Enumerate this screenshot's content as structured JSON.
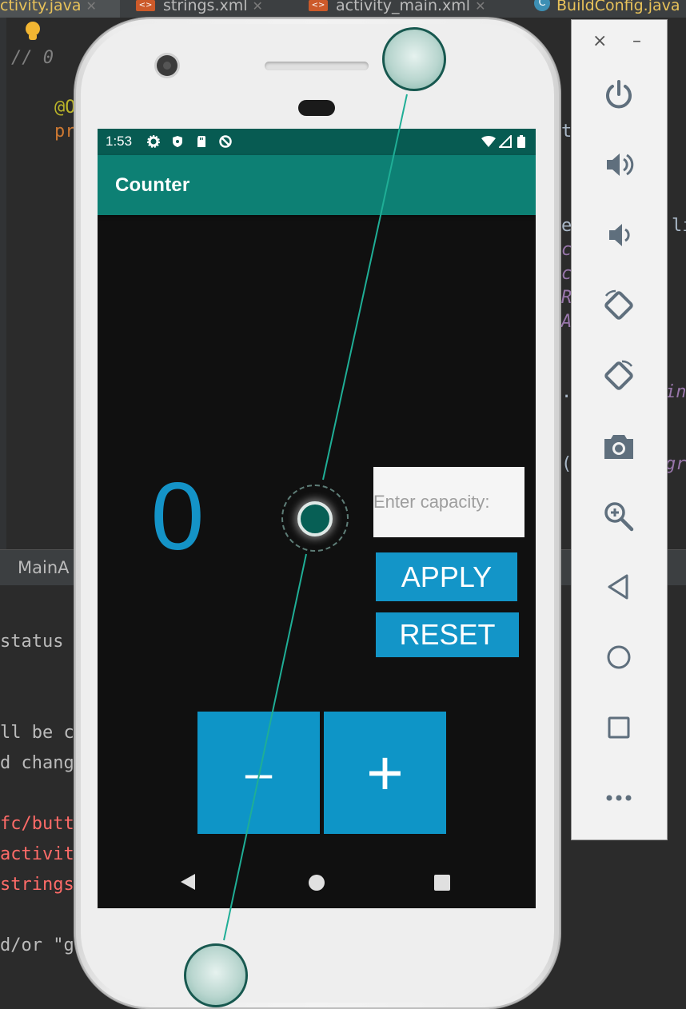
{
  "ide": {
    "tabs": [
      "ctivity.java",
      "strings.xml",
      "activity_main.xml",
      "BuildConfig.java"
    ],
    "code_top": "// 0",
    "code_annotation": "@O",
    "code_pr": "pr",
    "code_right": [
      "t",
      "e",
      "li",
      "c",
      "c",
      "R",
      "A",
      ".",
      "int",
      "(",
      "gre"
    ],
    "panel_tab": "MainA",
    "console_lines": [
      "status",
      "ll be c",
      "d chang",
      "fc/butt",
      "activit",
      "strings",
      "d/or \"g"
    ]
  },
  "app": {
    "status_time": "1:53",
    "title": "Counter",
    "counter_value": "0",
    "capacity_placeholder": "Enter capacity:",
    "capacity_value": "",
    "apply_label": "APPLY",
    "reset_label": "RESET",
    "decrement_label": "–",
    "increment_label": "+"
  },
  "emulator": {
    "close_label": "×",
    "minimize_label": "–",
    "buttons": [
      "power-icon",
      "volume-up-icon",
      "volume-down-icon",
      "rotate-left-icon",
      "rotate-right-icon",
      "camera-icon",
      "zoom-icon",
      "back-icon",
      "home-icon",
      "overview-icon",
      "more-icon"
    ]
  },
  "colors": {
    "status_bar": "#075b52",
    "app_bar": "#0d8074",
    "accent": "#1395c8",
    "screen_bg": "#101010"
  }
}
